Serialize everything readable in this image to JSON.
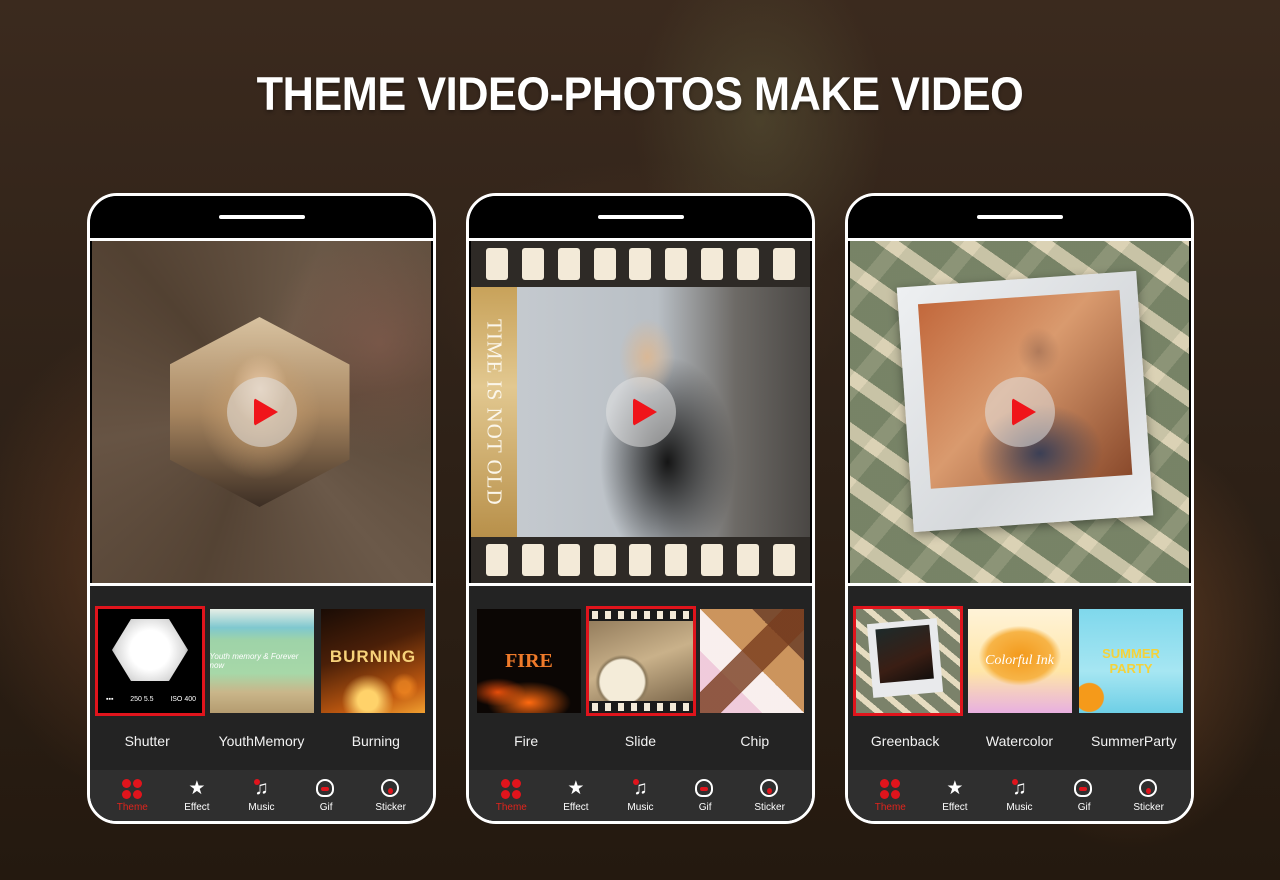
{
  "headline": "THEME VIDEO-PHOTOS MAKE VIDEO",
  "accent_color": "#e0141c",
  "tabs": [
    {
      "label": "Theme",
      "icon": "clover-icon",
      "active": true
    },
    {
      "label": "Effect",
      "icon": "star-wand-icon"
    },
    {
      "label": "Music",
      "icon": "music-note-icon"
    },
    {
      "label": "Gif",
      "icon": "octopus-icon"
    },
    {
      "label": "Sticker",
      "icon": "emoji-face-icon"
    }
  ],
  "phones": [
    {
      "preview": "shutter-theme-preview",
      "themes": [
        {
          "label": "Shutter",
          "selected": true,
          "meta": [
            "▪▪▪",
            "250 5.5",
            "ISO 400"
          ]
        },
        {
          "label": "YouthMemory",
          "thumb_text": "Youth memory & Forever now"
        },
        {
          "label": "Burning",
          "thumb_text": "BURNING"
        }
      ]
    },
    {
      "preview": "slide-theme-preview",
      "preview_text": "TIME IS NOT OLD",
      "themes": [
        {
          "label": "Fire",
          "thumb_text": "FIRE"
        },
        {
          "label": "Slide",
          "selected": true
        },
        {
          "label": "Chip"
        }
      ]
    },
    {
      "preview": "greenback-theme-preview",
      "themes": [
        {
          "label": "Greenback",
          "selected": true
        },
        {
          "label": "Watercolor",
          "thumb_text": "Colorful Ink"
        },
        {
          "label": "SummerParty",
          "thumb_text": "SUMMER PARTY"
        }
      ]
    }
  ]
}
